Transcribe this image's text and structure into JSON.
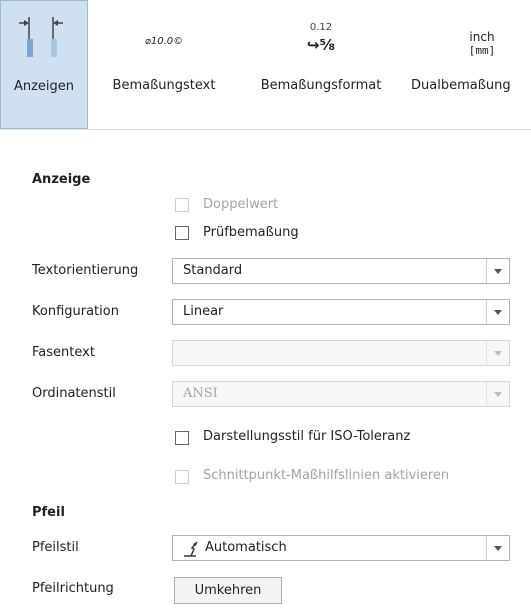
{
  "ribbon": {
    "buttons": [
      {
        "label": "Anzeigen",
        "icon": "show-dimension-icon"
      },
      {
        "label": "Bemaßungstext",
        "icon_text": "⌀10.0©"
      },
      {
        "label": "Bemaßungsformat",
        "icon_top": "0.12",
        "icon_bottom": "↪⁵⁄₈"
      },
      {
        "label": "Dualbemaßung",
        "icon_top": "inch",
        "icon_bottom": "[mm]"
      }
    ]
  },
  "anzeige": {
    "title": "Anzeige",
    "doppelwert": "Doppelwert",
    "pruefbemassung": "Prüfbemaßung",
    "textorientierung_label": "Textorientierung",
    "textorientierung_value": "Standard",
    "konfiguration_label": "Konfiguration",
    "konfiguration_value": "Linear",
    "fasentext_label": "Fasentext",
    "fasentext_value": "",
    "ordinatenstil_label": "Ordinatenstil",
    "ordinatenstil_value": "ANSI",
    "iso_toleranz": "Darstellungsstil für ISO-Toleranz",
    "schnittpunkt": "Schnittpunkt-Maßhilfslinien aktivieren"
  },
  "pfeil": {
    "title": "Pfeil",
    "pfeilstil_label": "Pfeilstil",
    "pfeilstil_value": "Automatisch",
    "pfeilrichtung_label": "Pfeilrichtung",
    "umkehren_label": "Umkehren"
  }
}
